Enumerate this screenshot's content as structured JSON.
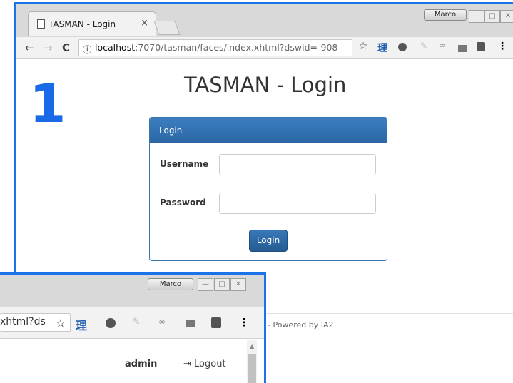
{
  "step_number": "1",
  "window1": {
    "tab_title": "TASMAN - Login",
    "tab_close": "×",
    "user_badge": "Marco",
    "url_host": "localhost",
    "url_path": ":7070/tasman/faces/index.xhtml?dswid=-908",
    "page_title": "TASMAN - Login",
    "panel_title": "Login",
    "username_label": "Username",
    "password_label": "Password",
    "login_button": "Login",
    "footer": "- Powered by IA2"
  },
  "window2": {
    "user_badge": "Marco",
    "url_fragment": "xhtml?ds",
    "user_name": "admin",
    "logout_label": "Logout"
  },
  "toolbar": {
    "back": "←",
    "forward": "→",
    "reload": "C",
    "info": "ⓘ",
    "star": "☆",
    "ext_li": "理",
    "menu": "⋮"
  },
  "colors": {
    "highlight_border": "#1a73e8",
    "step_number": "#1a6ae8",
    "panel_header": "#2b66a4",
    "button": "#2a649f"
  },
  "icons": [
    "document-icon",
    "close-icon",
    "back-arrow-icon",
    "forward-arrow-icon",
    "reload-icon",
    "info-icon",
    "star-icon",
    "li-extension-icon",
    "circle-extension-icon",
    "feather-extension-icon",
    "link-extension-icon",
    "box-extension-icon",
    "bulb-extension-icon",
    "kebab-menu-icon",
    "logout-icon"
  ]
}
